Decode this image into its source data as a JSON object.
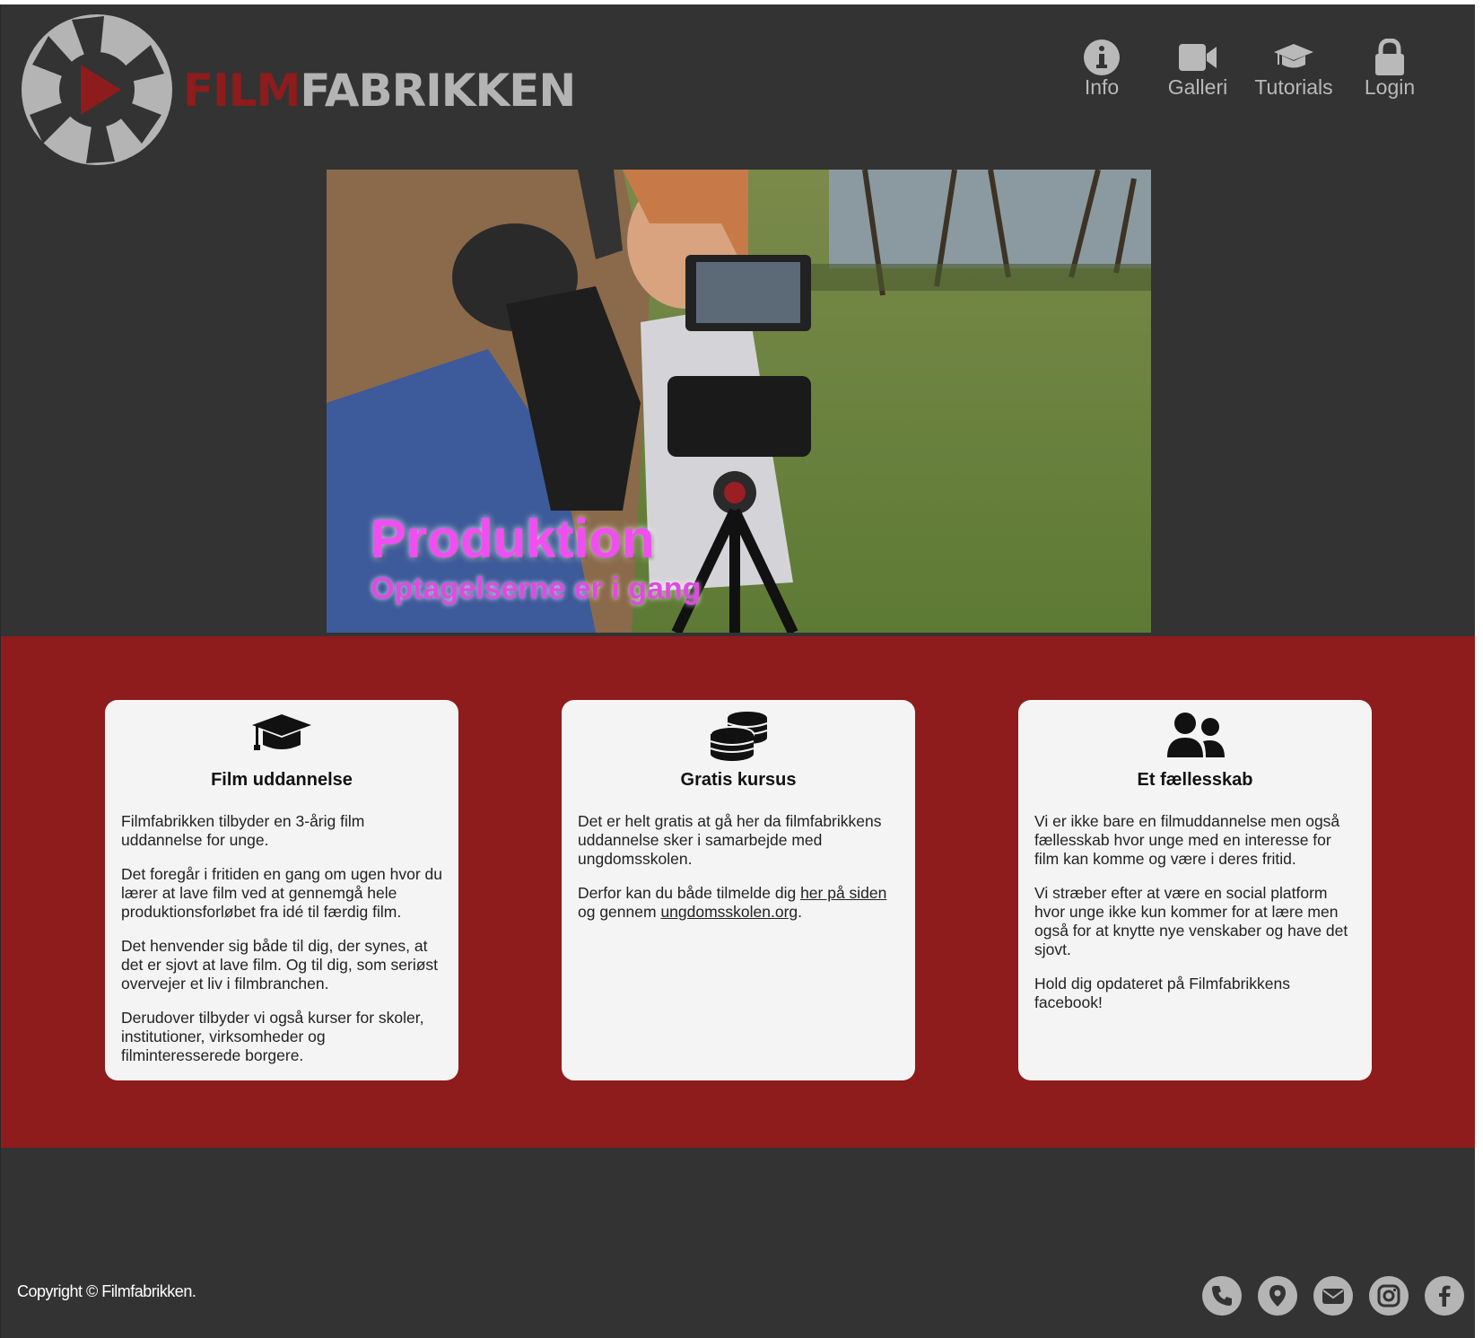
{
  "header": {
    "logo_film": "FILM",
    "logo_fabrikken": "FABRIKKEN",
    "nav": [
      {
        "label": "Info",
        "icon": "info-icon"
      },
      {
        "label": "Galleri",
        "icon": "video-camera-icon"
      },
      {
        "label": "Tutorials",
        "icon": "graduation-cap-icon"
      },
      {
        "label": "Login",
        "icon": "lock-icon"
      }
    ]
  },
  "hero": {
    "title": "Produktion",
    "subtitle": "Optagelserne er i gang"
  },
  "cards": [
    {
      "icon": "graduation-cap-icon",
      "title": "Film uddannelse",
      "paragraphs": [
        "Filmfabrikken tilbyder en 3-årig film uddannelse for unge.",
        "Det foregår i fritiden en gang om ugen hvor du lærer at lave film ved at gennemgå hele produktionsforløbet fra idé til færdig film.",
        "Det henvender sig både til dig, der synes, at det er sjovt at lave film. Og til dig, som seriøst overvejer et liv i filmbranchen.",
        "Derudover tilbyder vi også kurser for skoler, institutioner, virksomheder og filminteresserede borgere."
      ]
    },
    {
      "icon": "coins-icon",
      "title": "Gratis kursus",
      "paragraphs": [
        "Det er helt gratis at gå her da filmfabrikkens uddannelse sker i samarbejde med ungdomsskolen."
      ],
      "p2_before": "Derfor kan du både tilmelde dig ",
      "p2_link1": "her på siden",
      "p2_middle": " og gennem ",
      "p2_link2": "ungdomsskolen.org",
      "p2_after": "."
    },
    {
      "icon": "users-icon",
      "title": "Et fællesskab",
      "paragraphs": [
        "Vi er ikke bare en filmuddannelse men også fællesskab hvor unge med en interesse for film kan komme og være i deres fritid.",
        "Vi stræber efter at være en social platform hvor unge ikke kun kommer for at lære men også for at knytte nye venskaber og have det sjovt.",
        "Hold dig opdateret på Filmfabrikkens facebook!"
      ]
    }
  ],
  "footer": {
    "copyright": "Copyright © Filmfabrikken.",
    "social": [
      "phone-icon",
      "map-pin-icon",
      "envelope-icon",
      "instagram-icon",
      "facebook-icon"
    ]
  },
  "colors": {
    "background": "#333333",
    "brand_red": "#8e1c1c",
    "card": "#f4f4f4",
    "nav_grey": "#b9b9b9"
  }
}
